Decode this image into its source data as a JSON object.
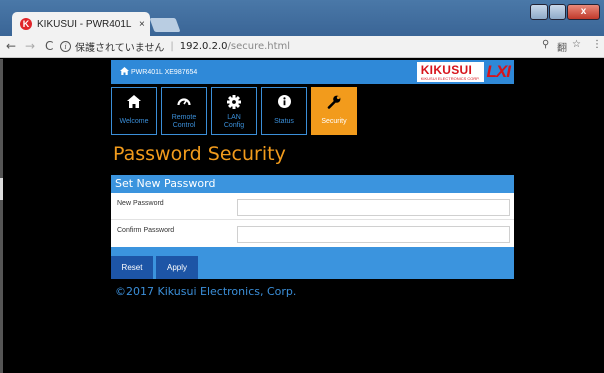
{
  "browser": {
    "tab_title": "KIKUSUI - PWR401L",
    "tab_close": "×",
    "favicon_letter": "K",
    "back": "←",
    "forward": "→",
    "reload": "C",
    "info": "i",
    "security_status": "保護されていません",
    "url_host": "192.0.2.0",
    "url_path": "/secure.html",
    "win_close": "x",
    "icons": {
      "zoom": "⚲",
      "translate": "翻",
      "star": "☆",
      "menu": "⋮"
    }
  },
  "header": {
    "device_name": "PWR401L XE987654",
    "logo_kikusui": "KIKUSUI",
    "logo_sub": "KIKUSUI ELECTRONICS CORP.",
    "logo_lxi": "LXI"
  },
  "nav": {
    "items": [
      {
        "label": "Welcome",
        "icon": "home-icon"
      },
      {
        "label": "Remote\nControl",
        "icon": "gauge-icon"
      },
      {
        "label": "LAN\nConfig",
        "icon": "gear-icon"
      },
      {
        "label": "Status",
        "icon": "info-icon"
      },
      {
        "label": "Security",
        "icon": "wrench-icon",
        "active": true
      }
    ]
  },
  "main": {
    "title": "Password Security",
    "form": {
      "heading": "Set New Password",
      "new_password_label": "New Password",
      "confirm_password_label": "Confirm Password",
      "new_password_value": "",
      "confirm_password_value": "",
      "reset_label": "Reset",
      "apply_label": "Apply"
    },
    "copyright": "©2017 Kikusui Electronics, Corp."
  },
  "colors": {
    "accent_orange": "#f29b1c",
    "header_blue": "#2f89d8",
    "button_blue": "#1d55a6",
    "logo_red": "#d6141c"
  }
}
